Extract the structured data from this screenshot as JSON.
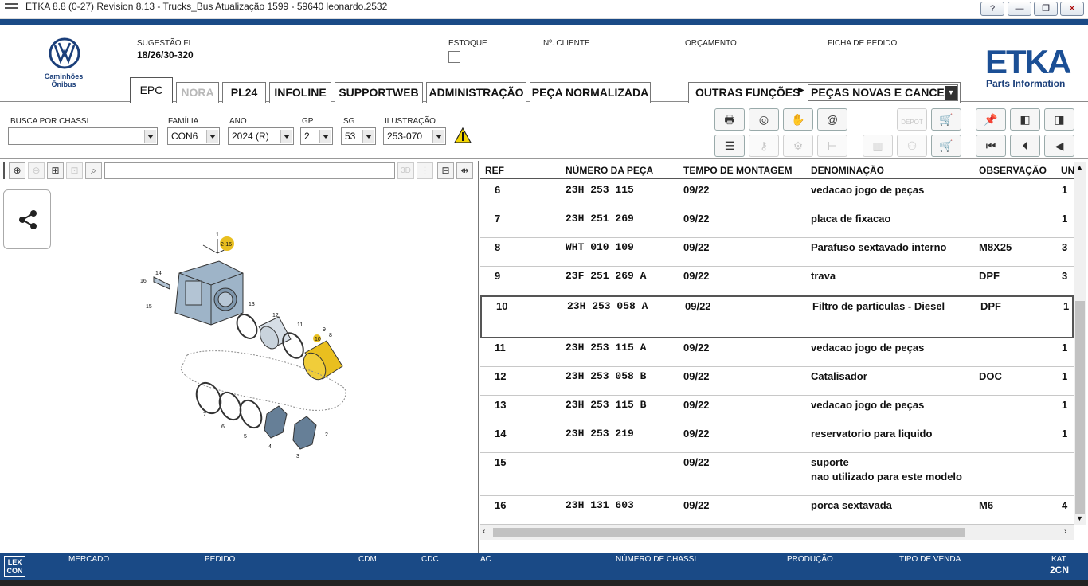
{
  "window": {
    "title": "ETKA 8.8 (0-27) Revision 8.13 - Trucks_Bus Atualização 1599 - 59640 leonardo.2532",
    "buttons": [
      "?",
      "—",
      "❐",
      "✕"
    ]
  },
  "brand": {
    "vw_sub1": "Caminhões",
    "vw_sub2": "Ônibus",
    "etka_logo": "ETKA",
    "etka_tagline": "Parts Information"
  },
  "header": {
    "sugestao_label": "SUGESTÃO FI",
    "sugestao_value": "18/26/30-320",
    "estoque_label": "ESTOQUE",
    "cliente_label": "Nº. CLIENTE",
    "orcamento_label": "ORÇAMENTO",
    "ficha_label": "FICHA DE PEDIDO"
  },
  "tabs": [
    {
      "label": "EPC"
    },
    {
      "label": "NORA"
    },
    {
      "label": "PL24"
    },
    {
      "label": "INFOLINE"
    },
    {
      "label": "SUPPORTWEB"
    },
    {
      "label": "ADMINISTRAÇÃO"
    },
    {
      "label": "PEÇA NORMALIZADA"
    }
  ],
  "outras": {
    "label": "OUTRAS FUNÇÕES",
    "selected": "PEÇAS NOVAS E CANCEL."
  },
  "filters": {
    "chassi_label": "BUSCA POR CHASSI",
    "chassi_value": "",
    "familia_label": "FAMÍLIA",
    "familia_value": "CON6",
    "ano_label": "ANO",
    "ano_value": "2024 (R)",
    "gp_label": "GP",
    "gp_value": "2",
    "sg_label": "SG",
    "sg_value": "53",
    "ilustracao_label": "ILUSTRAÇÃO",
    "ilustracao_value": "253-070"
  },
  "toolbar": {
    "depot_label": "DEPOT"
  },
  "table": {
    "headers": {
      "ref": "REF",
      "numero": "NÚMERO DA PEÇA",
      "tempo": "TEMPO DE MONTAGEM",
      "denominacao": "DENOMINAÇÃO",
      "observacao": "OBSERVAÇÃO",
      "un": "UN"
    },
    "rows": [
      {
        "ref": "6",
        "numero": "23H 253 115",
        "tempo": "09/22",
        "denominacao": "vedacao jogo de peças",
        "denominacao2": "",
        "observacao": "",
        "un": "1"
      },
      {
        "ref": "7",
        "numero": "23H 251 269",
        "tempo": "09/22",
        "denominacao": "placa de fixacao",
        "denominacao2": "",
        "observacao": "",
        "un": "1"
      },
      {
        "ref": "8",
        "numero": "WHT 010 109",
        "tempo": "09/22",
        "denominacao": "Parafuso sextavado interno",
        "denominacao2": "",
        "observacao": "M8X25",
        "un": "3"
      },
      {
        "ref": "9",
        "numero": "23F 251 269 A",
        "tempo": "09/22",
        "denominacao": "trava",
        "denominacao2": "",
        "observacao": "DPF",
        "un": "3"
      },
      {
        "ref": "10",
        "numero": "23H 253 058 A",
        "tempo": "09/22",
        "denominacao": "Filtro de particulas - Diesel",
        "denominacao2": "",
        "observacao": "DPF",
        "un": "1"
      },
      {
        "ref": "11",
        "numero": "23H 253 115 A",
        "tempo": "09/22",
        "denominacao": "vedacao jogo de peças",
        "denominacao2": "",
        "observacao": "",
        "un": "1"
      },
      {
        "ref": "12",
        "numero": "23H 253 058 B",
        "tempo": "09/22",
        "denominacao": "Catalisador",
        "denominacao2": "",
        "observacao": "DOC",
        "un": "1"
      },
      {
        "ref": "13",
        "numero": "23H 253 115 B",
        "tempo": "09/22",
        "denominacao": "vedacao jogo de peças",
        "denominacao2": "",
        "observacao": "",
        "un": "1"
      },
      {
        "ref": "14",
        "numero": "23H 253 219",
        "tempo": "09/22",
        "denominacao": "reservatorio para liquido",
        "denominacao2": "",
        "observacao": "",
        "un": "1"
      },
      {
        "ref": "15",
        "numero": "",
        "tempo": "09/22",
        "denominacao": "suporte",
        "denominacao2": "nao utilizado para este modelo",
        "observacao": "",
        "un": ""
      },
      {
        "ref": "16",
        "numero": "23H 131 603",
        "tempo": "09/22",
        "denominacao": "porca sextavada",
        "denominacao2": "",
        "observacao": "M6",
        "un": "4"
      }
    ]
  },
  "diagram": {
    "callouts": [
      "1",
      "2-16",
      "14",
      "16",
      "5",
      "15",
      "13",
      "12",
      "11",
      "10",
      "9",
      "8",
      "7",
      "6",
      "5",
      "4",
      "3",
      "2"
    ]
  },
  "statusbar": {
    "lexcon": "LEX CON",
    "mercado": "MERCADO",
    "pedido": "PEDIDO",
    "cdm": "CDM",
    "cdc": "CDC",
    "ac": "AC",
    "chassi": "NÚMERO DE CHASSI",
    "producao": "PRODUÇÃO",
    "tipo": "TIPO DE VENDA",
    "kat_label": "KAT",
    "kat_value": "2CN"
  }
}
